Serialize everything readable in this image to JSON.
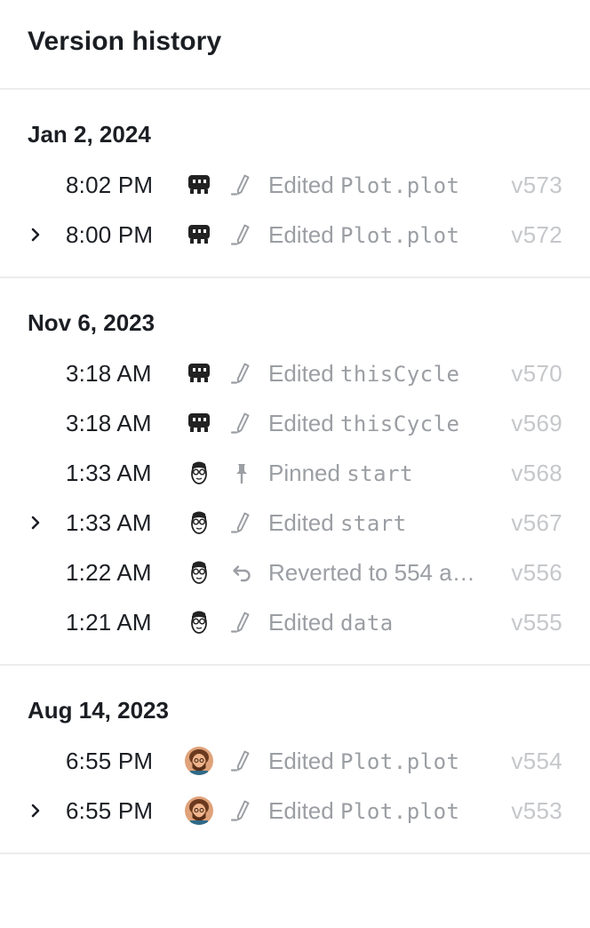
{
  "header": {
    "title": "Version history"
  },
  "groups": [
    {
      "date": "Jan 2, 2024",
      "rows": [
        {
          "time": "8:02 PM",
          "avatar": "pixel-avatar",
          "action_icon": "pencil-icon",
          "verb": "Edited ",
          "target": "Plot.plot",
          "version": "v573",
          "expandable": false
        },
        {
          "time": "8:00 PM",
          "avatar": "pixel-avatar",
          "action_icon": "pencil-icon",
          "verb": "Edited ",
          "target": "Plot.plot",
          "version": "v572",
          "expandable": true
        }
      ]
    },
    {
      "date": "Nov 6, 2023",
      "rows": [
        {
          "time": "3:18 AM",
          "avatar": "pixel-avatar",
          "action_icon": "pencil-icon",
          "verb": "Edited ",
          "target": "thisCycle",
          "version": "v570",
          "expandable": false
        },
        {
          "time": "3:18 AM",
          "avatar": "pixel-avatar",
          "action_icon": "pencil-icon",
          "verb": "Edited ",
          "target": "thisCycle",
          "version": "v569",
          "expandable": false
        },
        {
          "time": "1:33 AM",
          "avatar": "glasses-avatar",
          "action_icon": "pin-icon",
          "verb": "Pinned ",
          "target": "start",
          "version": "v568",
          "expandable": false
        },
        {
          "time": "1:33 AM",
          "avatar": "glasses-avatar",
          "action_icon": "pencil-icon",
          "verb": "Edited ",
          "target": "start",
          "version": "v567",
          "expandable": true
        },
        {
          "time": "1:22 AM",
          "avatar": "glasses-avatar",
          "action_icon": "revert-icon",
          "verb": "Reverted to 554 and more",
          "target": "",
          "version": "v556",
          "expandable": false
        },
        {
          "time": "1:21 AM",
          "avatar": "glasses-avatar",
          "action_icon": "pencil-icon",
          "verb": "Edited ",
          "target": "data",
          "version": "v555",
          "expandable": false
        }
      ]
    },
    {
      "date": "Aug 14, 2023",
      "rows": [
        {
          "time": "6:55 PM",
          "avatar": "photo-avatar",
          "action_icon": "pencil-icon",
          "verb": "Edited ",
          "target": "Plot.plot",
          "version": "v554",
          "expandable": false
        },
        {
          "time": "6:55 PM",
          "avatar": "photo-avatar",
          "action_icon": "pencil-icon",
          "verb": "Edited ",
          "target": "Plot.plot",
          "version": "v553",
          "expandable": true
        }
      ]
    }
  ],
  "colors": {
    "text": "#1b1e23",
    "muted": "#9b9ea3",
    "version": "#c5c7ca",
    "divider": "#ececec"
  }
}
